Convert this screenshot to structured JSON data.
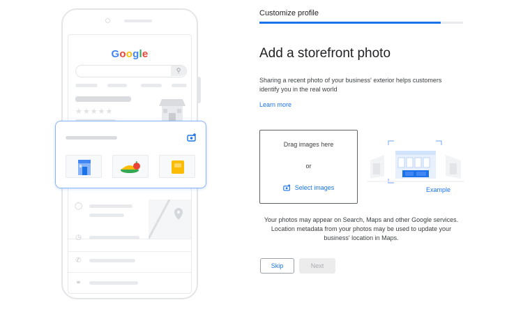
{
  "illustration": {
    "logo_letters": [
      "G",
      "o",
      "o",
      "g",
      "l",
      "e"
    ],
    "colors": {
      "blue": "#4285f4",
      "red": "#ea4335",
      "yellow": "#fbbc05",
      "green": "#34a853"
    }
  },
  "header": {
    "step_label": "Customize profile",
    "progress": 0.89
  },
  "main": {
    "title": "Add a storefront photo",
    "description": "Sharing a recent photo of your business' exterior helps customers identify you in the real world",
    "learn_more": "Learn more"
  },
  "dropzone": {
    "drag_text": "Drag images here",
    "or_text": "or",
    "select_label": "Select images",
    "icon": "add-photo-icon"
  },
  "example": {
    "label": "Example"
  },
  "notice": "Your photos may appear on Search, Maps and other Google services. Location metadata from your photos may be used to update your business' location in Maps.",
  "buttons": {
    "skip": "Skip",
    "next": "Next"
  },
  "theme": {
    "accent": "#1a73e8",
    "disabled_bg": "#ececec"
  }
}
